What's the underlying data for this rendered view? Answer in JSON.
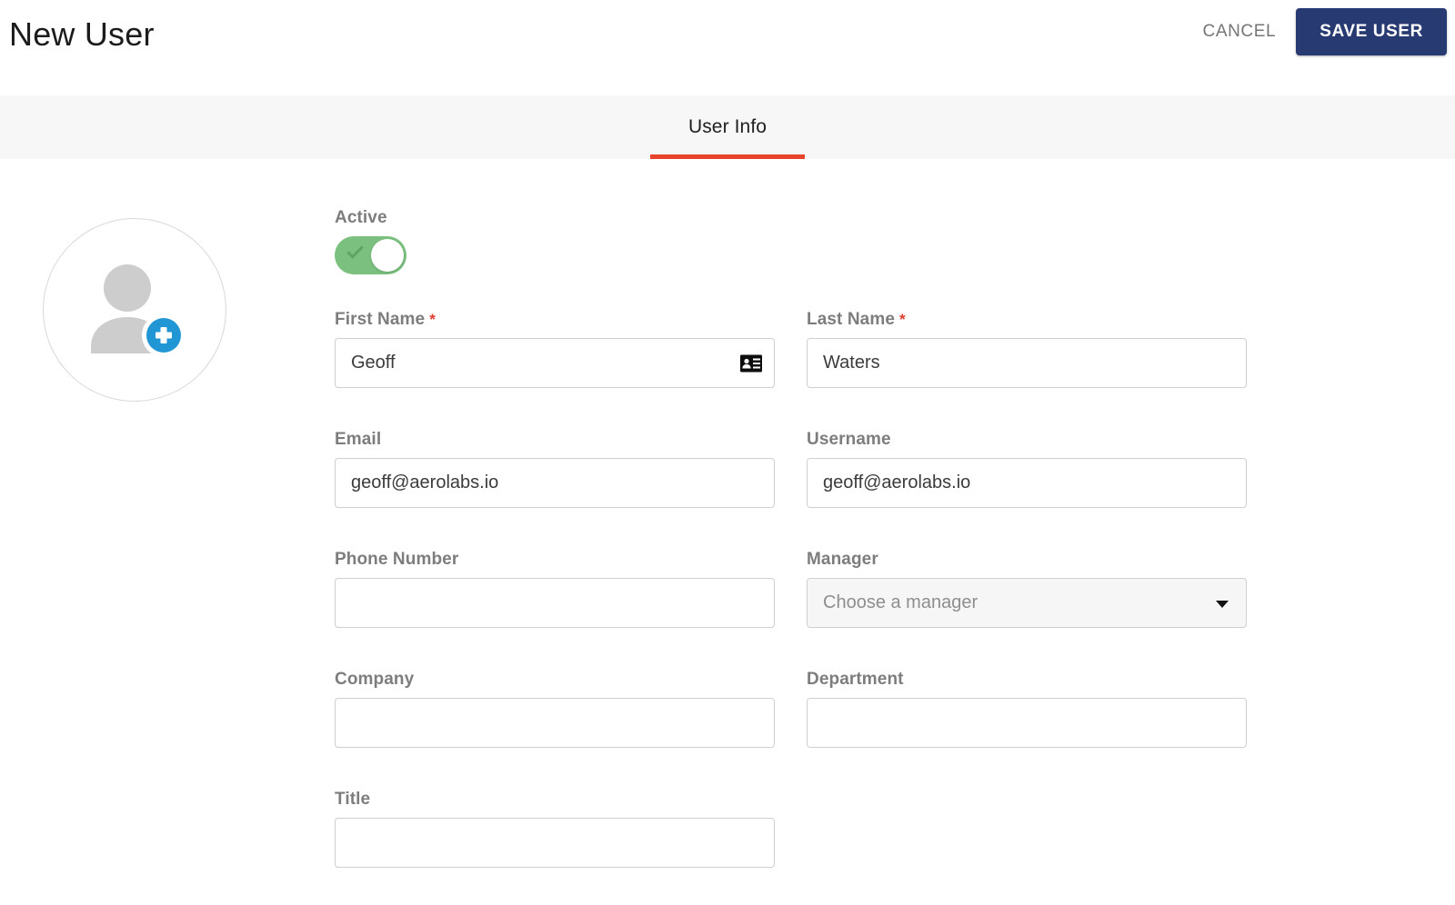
{
  "header": {
    "title": "New User",
    "cancel_label": "CANCEL",
    "save_label": "SAVE USER",
    "save_bg": "#283a72"
  },
  "tabs": [
    {
      "label": "User Info",
      "active": true,
      "indicator_color": "#e8432b"
    }
  ],
  "avatar": {
    "icon": "person-add-icon",
    "badge_color": "#2196d4",
    "silhouette_color": "#cdcdcd"
  },
  "form": {
    "active_toggle": {
      "label": "Active",
      "state": "on",
      "track_color": "#7bc07f"
    },
    "fields": [
      {
        "name": "first_name",
        "label": "First Name",
        "required": true,
        "value": "Geoff",
        "placeholder": "",
        "type": "text",
        "trailing_icon": "contact-card-icon"
      },
      {
        "name": "last_name",
        "label": "Last Name",
        "required": true,
        "value": "Waters",
        "placeholder": "",
        "type": "text"
      },
      {
        "name": "email",
        "label": "Email",
        "required": false,
        "value": "geoff@aerolabs.io",
        "placeholder": "",
        "type": "text"
      },
      {
        "name": "username",
        "label": "Username",
        "required": false,
        "value": "geoff@aerolabs.io",
        "placeholder": "",
        "type": "text"
      },
      {
        "name": "phone_number",
        "label": "Phone Number",
        "required": false,
        "value": "",
        "placeholder": "",
        "type": "text"
      },
      {
        "name": "manager",
        "label": "Manager",
        "required": false,
        "value": "",
        "placeholder": "Choose a manager",
        "type": "select"
      },
      {
        "name": "company",
        "label": "Company",
        "required": false,
        "value": "",
        "placeholder": "",
        "type": "text"
      },
      {
        "name": "department",
        "label": "Department",
        "required": false,
        "value": "",
        "placeholder": "",
        "type": "text"
      },
      {
        "name": "title",
        "label": "Title",
        "required": false,
        "value": "",
        "placeholder": "",
        "type": "text"
      }
    ]
  }
}
